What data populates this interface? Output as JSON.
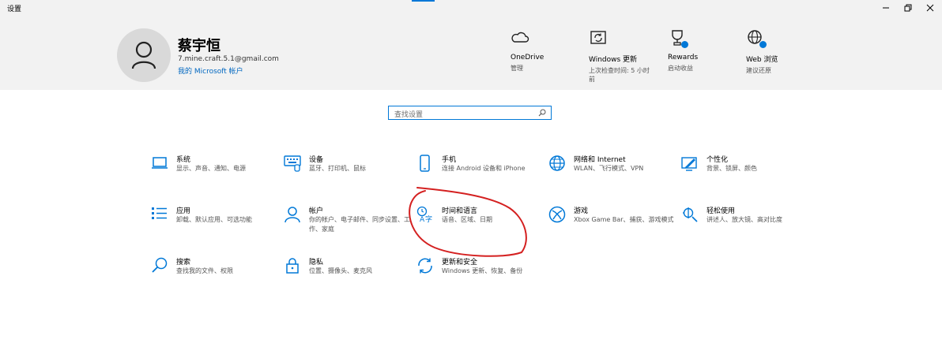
{
  "window": {
    "title": "设置",
    "accent_color": "#0078d7"
  },
  "profile": {
    "name": "蔡宇恒",
    "email": "7.mine.craft.5.1@gmail.com",
    "account_link": "我的 Microsoft 帐户"
  },
  "header_links": [
    {
      "label": "OneDrive",
      "sub": "管理",
      "icon": "cloud-icon"
    },
    {
      "label": "Windows 更新",
      "sub": "上次检查时间: 5 小时前",
      "icon": "windows-update-icon"
    },
    {
      "label": "Rewards",
      "sub": "启动收益",
      "icon": "trophy-icon"
    },
    {
      "label": "Web 浏览",
      "sub": "建议还原",
      "icon": "globe-icon"
    }
  ],
  "search": {
    "placeholder": "查找设置"
  },
  "categories": [
    {
      "title": "系统",
      "desc": "显示、声音、通知、电源",
      "icon": "laptop-icon"
    },
    {
      "title": "设备",
      "desc": "蓝牙、打印机、鼠标",
      "icon": "keyboard-icon"
    },
    {
      "title": "手机",
      "desc": "连接 Android 设备和 iPhone",
      "icon": "phone-icon"
    },
    {
      "title": "网络和 Internet",
      "desc": "WLAN、飞行模式、VPN",
      "icon": "globe-icon"
    },
    {
      "title": "个性化",
      "desc": "背景、锁屏、颜色",
      "icon": "paint-icon"
    },
    {
      "title": "应用",
      "desc": "卸载、默认应用、可选功能",
      "icon": "apps-list-icon"
    },
    {
      "title": "帐户",
      "desc": "你的帐户、电子邮件、同步设置、工作、家庭",
      "icon": "person-icon"
    },
    {
      "title": "时间和语言",
      "desc": "语音、区域、日期",
      "icon": "time-language-icon"
    },
    {
      "title": "游戏",
      "desc": "Xbox Game Bar、捕获、游戏模式",
      "icon": "xbox-icon"
    },
    {
      "title": "轻松使用",
      "desc": "讲述人、放大镜、高对比度",
      "icon": "accessibility-icon"
    },
    {
      "title": "搜索",
      "desc": "查找我的文件、权限",
      "icon": "search-icon"
    },
    {
      "title": "隐私",
      "desc": "位置、摄像头、麦克风",
      "icon": "lock-icon"
    },
    {
      "title": "更新和安全",
      "desc": "Windows 更新、恢复、备份",
      "icon": "sync-icon"
    }
  ],
  "annotation": {
    "color": "#d42020"
  }
}
